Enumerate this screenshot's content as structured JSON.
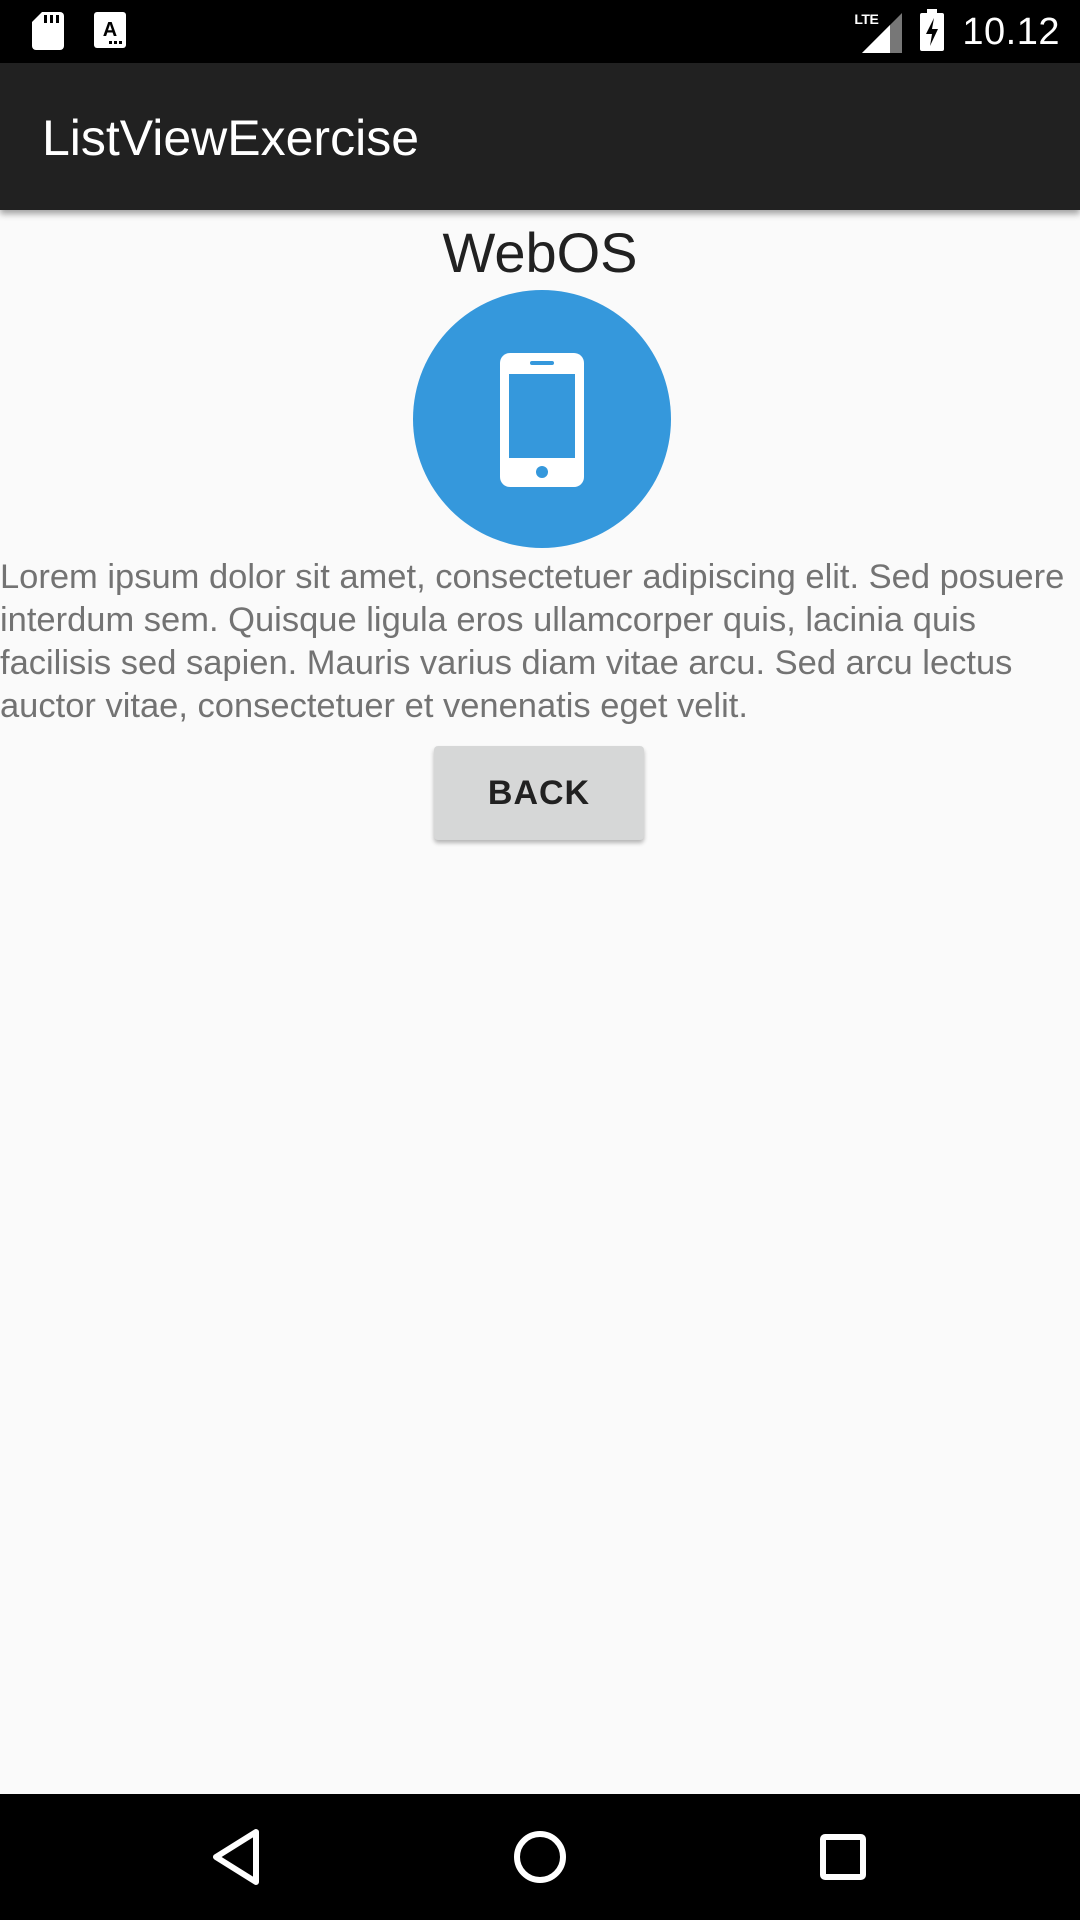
{
  "status_bar": {
    "network_label": "LTE",
    "time": "10.12",
    "icons": [
      "sd-card-icon",
      "a-notification-icon",
      "lte-signal-icon",
      "battery-charging-icon"
    ]
  },
  "app_bar": {
    "title": "ListViewExercise"
  },
  "detail": {
    "title": "WebOS",
    "image_icon": "smartphone-icon",
    "image_color": "#3598dc",
    "description": "Lorem ipsum dolor sit amet, consectetuer adipiscing elit. Sed posuere interdum sem. Quisque ligula eros ullamcorper quis, lacinia quis facilisis sed sapien. Mauris varius diam vitae arcu. Sed arcu lectus auctor vitae, consectetuer et venenatis eget velit.",
    "back_label": "BACK"
  },
  "nav_bar": {
    "icons": [
      "nav-back-icon",
      "nav-home-icon",
      "nav-recents-icon"
    ]
  },
  "colors": {
    "app_bar": "#212121",
    "background": "#fafafa",
    "button": "#d6d7d7",
    "accent": "#3598dc"
  }
}
